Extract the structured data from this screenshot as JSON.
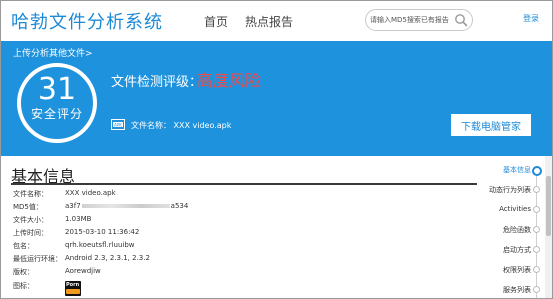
{
  "header": {
    "brand": "哈勃文件分析系统",
    "nav": [
      "首页",
      "热点报告"
    ],
    "search_placeholder": "请输入MD5搜索已有报告",
    "login": "登录"
  },
  "banner": {
    "breadcrumb": "上传分析其他文件>",
    "score": "31",
    "score_label": "安全评分",
    "rating_label": "文件检测评级：",
    "rating_value": "高度风险",
    "filename_label": "文件名称：  XXX video.apk",
    "download_button": "下载电脑管家"
  },
  "info": {
    "title": "基本信息",
    "rows": [
      {
        "label": "文件名称：",
        "value": "XXX video.apk"
      },
      {
        "label": "MD5值：",
        "value_prefix": "a3f7",
        "value_suffix": "a534"
      },
      {
        "label": "文件大小：",
        "value": "1.03MB"
      },
      {
        "label": "上传时间：",
        "value": "2015-03-10 11:36:42"
      },
      {
        "label": "包名：",
        "value": "qrh.koeutsfl.rluuibw"
      },
      {
        "label": "最低运行环境：",
        "value": "Android 2.3, 2.3.1, 2.3.2"
      },
      {
        "label": "版权：",
        "value": "Aorewdjiw"
      },
      {
        "label": "图标：",
        "icon_text": "Porn"
      }
    ]
  },
  "sidenav": {
    "items": [
      "基本信息",
      "动态行为列表",
      "Activities",
      "危险函数",
      "启动方式",
      "权限列表",
      "服务列表"
    ],
    "active_index": 0
  },
  "colors": {
    "brand_blue": "#1d8ad6",
    "banner_blue": "#1f92dd",
    "risk_red": "#f04b4b"
  }
}
